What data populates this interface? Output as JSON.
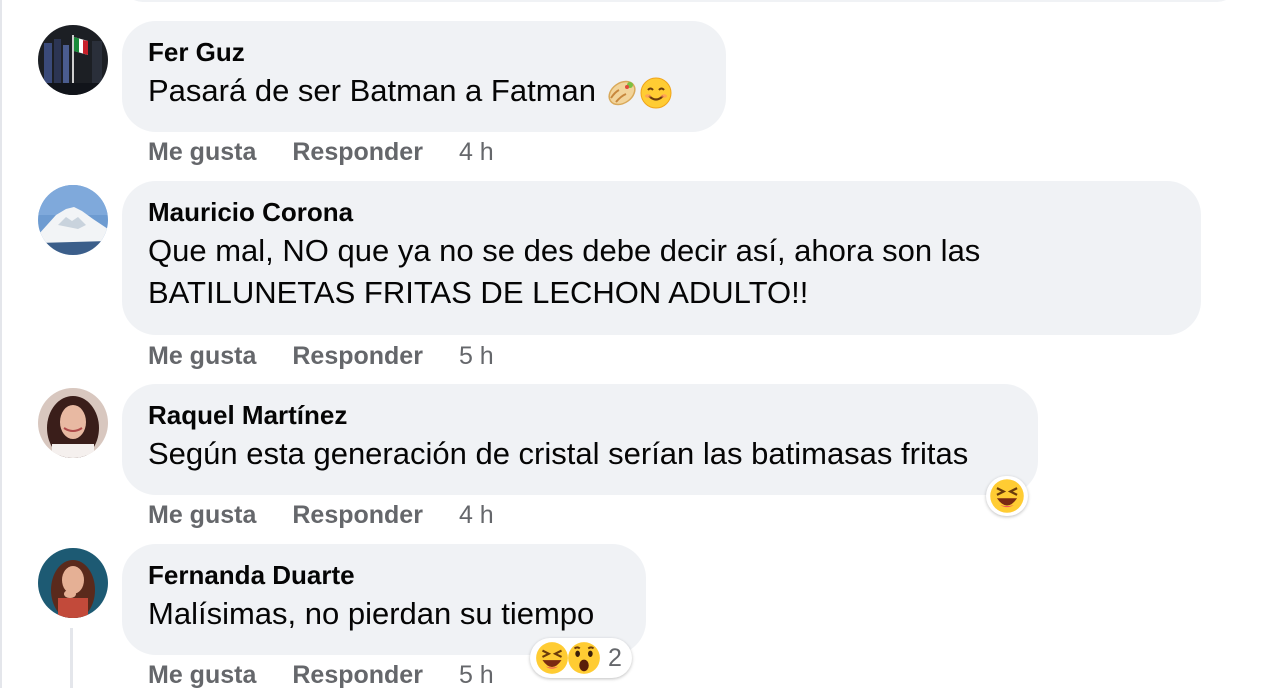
{
  "comments": [
    {
      "author": "Fer Guz",
      "text": "Pasará de ser Batman a Fatman",
      "like_label": "Me gusta",
      "reply_label": "Responder",
      "time": "4 h"
    },
    {
      "author": "Mauricio Corona",
      "text_line1": "Que mal, NO que ya no se des debe decir así, ahora son las",
      "text_line2": "BATILUNETAS FRITAS DE LECHON ADULTO!!",
      "like_label": "Me gusta",
      "reply_label": "Responder",
      "time": "5 h"
    },
    {
      "author": "Raquel Martínez",
      "text": "Según esta generación de cristal serían las batimasas fritas",
      "like_label": "Me gusta",
      "reply_label": "Responder",
      "time": "4 h",
      "reactions": [
        "laughing-emoji"
      ]
    },
    {
      "author": "Fernanda Duarte",
      "text": "Malísimas, no pierdan su tiempo",
      "like_label": "Me gusta",
      "reply_label": "Responder",
      "time": "5 h",
      "reactions": [
        "laughing-emoji",
        "wow-emoji"
      ],
      "reaction_count": "2"
    }
  ],
  "colors": {
    "bubble": "#f0f2f5",
    "meta_text": "#65676b",
    "text": "#050505"
  }
}
